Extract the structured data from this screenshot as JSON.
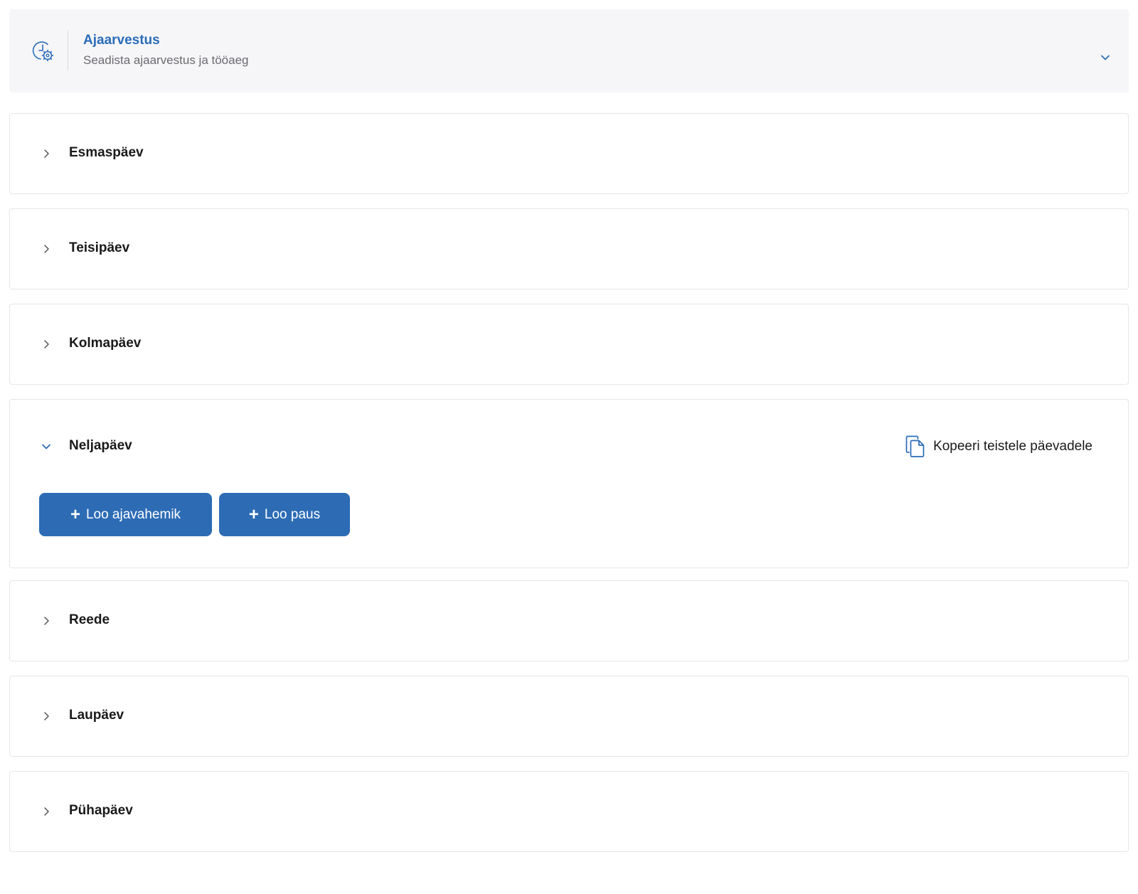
{
  "header": {
    "title": "Ajaarvestus",
    "subtitle": "Seadista ajaarvestus ja tööaeg",
    "icon": "clock-settings-icon",
    "toggle_icon": "chevron-down-icon",
    "accent_color": "#2b6cb8"
  },
  "days": [
    {
      "label": "Esmaspäev",
      "expanded": false
    },
    {
      "label": "Teisipäev",
      "expanded": false
    },
    {
      "label": "Kolmapäev",
      "expanded": false
    },
    {
      "label": "Neljapäev",
      "expanded": true
    },
    {
      "label": "Reede",
      "expanded": false
    },
    {
      "label": "Laupäev",
      "expanded": false
    },
    {
      "label": "Pühapäev",
      "expanded": false
    }
  ],
  "expanded_day": {
    "copy_label": "Kopeeri teistele päevadele",
    "copy_icon": "copy-icon",
    "buttons": {
      "create_interval": "Loo ajavahemik",
      "create_pause": "Loo paus",
      "plus_symbol": "+"
    },
    "button_color": "#2d6cb5"
  }
}
